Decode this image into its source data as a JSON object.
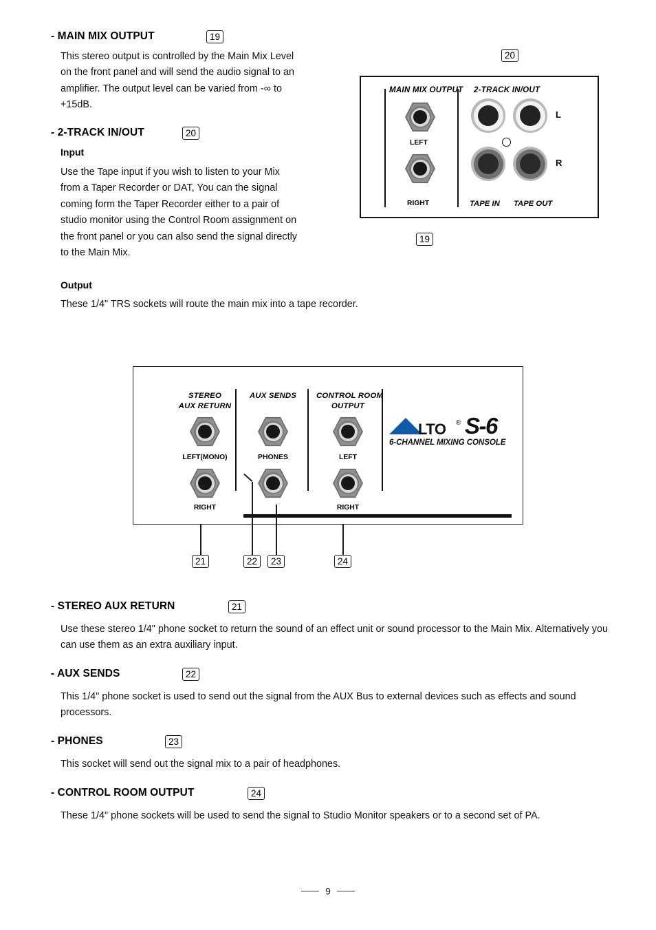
{
  "page": {
    "number": "9",
    "dash": ""
  },
  "sections": {
    "main_mix_output": {
      "title": "- MAIN MIX OUTPUT",
      "callout": "19",
      "body": "This stereo output is controlled by the Main Mix Level on the front panel and will send the audio signal to an amplifier. The output level can be varied from -∞ to +15dB."
    },
    "two_track": {
      "title": "- 2-TRACK IN/OUT",
      "callout": "20",
      "input_head": "Input",
      "input_body": "Use the Tape input if you wish to listen to your Mix from a Taper Recorder or DAT, You can the signal coming form the Taper Recorder either to a pair of studio monitor using the Control Room assignment on the front panel or you can also send the signal directly to the Main Mix.",
      "output_head": "Output",
      "output_body": "These 1/4\" TRS sockets will route the main mix into a tape recorder."
    },
    "stereo_aux_return": {
      "title": "- STEREO AUX RETURN",
      "callout": "21",
      "body": "Use these stereo 1/4\" phone socket to return the sound of an effect unit or sound processor to the Main Mix. Alternatively you can use them as an extra auxiliary input."
    },
    "aux_sends": {
      "title": "- AUX SENDS",
      "callout": "22",
      "body": "This 1/4\" phone socket is used to send out the signal from the AUX Bus to external devices such as effects and sound processors."
    },
    "phones": {
      "title": "- PHONES",
      "callout": "23",
      "body": "This socket will send out the signal mix to a pair of headphones."
    },
    "control_room_output": {
      "title": "- CONTROL ROOM OUTPUT",
      "callout": "24",
      "body": "These 1/4\" phone sockets will be used to send the signal to Studio Monitor speakers or to a second set of PA."
    }
  },
  "diagram_top": {
    "callout_top": "20",
    "callout_bottom": "19",
    "group_main_mix": "MAIN MIX OUTPUT",
    "group_two_track": "2-TRACK IN/OUT",
    "jacks": {
      "left": "LEFT",
      "right": "RIGHT",
      "tape_in": "TAPE IN",
      "tape_out": "TAPE OUT",
      "row_l": "L",
      "row_r": "R"
    }
  },
  "diagram_console": {
    "group_stereo_aux_return_line1": "STEREO",
    "group_stereo_aux_return_line2": "AUX RETURN",
    "group_aux_sends": "AUX SENDS",
    "group_control_room_line1": "CONTROL ROOM",
    "group_control_room_line2": "OUTPUT",
    "jacks": {
      "left_mono": "LEFT(MONO)",
      "right_aux": "RIGHT",
      "phones": "PHONES",
      "left_cr": "LEFT",
      "right_cr": "RIGHT"
    },
    "callouts": {
      "c21": "21",
      "c22": "22",
      "c23": "23",
      "c24": "24"
    },
    "logo": {
      "brand_text": "LTO",
      "registered": "®",
      "model": "S-6",
      "subtitle": "6-CHANNEL MIXING CONSOLE",
      "triangle_color": "#1059a8"
    }
  }
}
